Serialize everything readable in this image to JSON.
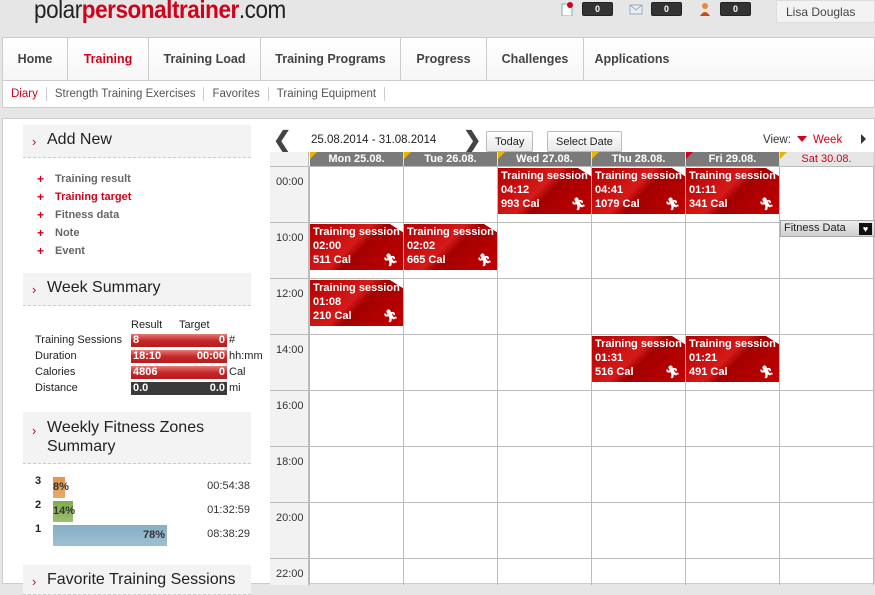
{
  "header": {
    "logo_prefix": "polar",
    "logo_brand": "personaltrainer",
    "logo_suffix": ".com",
    "notifications": [
      {
        "icon": "document-icon",
        "count": "0"
      },
      {
        "icon": "mail-icon",
        "count": "0"
      },
      {
        "icon": "person-icon",
        "count": "0"
      }
    ],
    "user_name": "Lisa Douglas"
  },
  "main_nav": [
    {
      "label": "Home",
      "active": false
    },
    {
      "label": "Training",
      "active": true
    },
    {
      "label": "Training Load",
      "active": false
    },
    {
      "label": "Training Programs",
      "active": false
    },
    {
      "label": "Progress",
      "active": false
    },
    {
      "label": "Challenges",
      "active": false
    },
    {
      "label": "Applications",
      "active": false
    }
  ],
  "sub_nav": [
    {
      "label": "Diary",
      "active": true
    },
    {
      "label": "Strength Training Exercises",
      "active": false
    },
    {
      "label": "Favorites",
      "active": false
    },
    {
      "label": "Training Equipment",
      "active": false
    }
  ],
  "sidebar": {
    "add_new": {
      "title": "Add New",
      "items": [
        "Training result",
        "Training target",
        "Fitness data",
        "Note",
        "Event"
      ]
    },
    "week_summary": {
      "title": "Week Summary",
      "col_result": "Result",
      "col_target": "Target",
      "rows": [
        {
          "label": "Training Sessions",
          "result": "8",
          "target": "0",
          "unit": "#"
        },
        {
          "label": "Duration",
          "result": "18:10",
          "target": "00:00",
          "unit": "hh:mm"
        },
        {
          "label": "Calories",
          "result": "4806",
          "target": "0",
          "unit": "Cal"
        },
        {
          "label": "Distance",
          "result": "0.0",
          "target": "0.0",
          "unit": "mi"
        }
      ]
    },
    "fitness_zones": {
      "title_line1": "Weekly Fitness Zones",
      "title_line2": "Summary",
      "zones": [
        {
          "zone": "3",
          "percent": "8%",
          "value": 8,
          "time": "00:54:38",
          "color": "#e0944a"
        },
        {
          "zone": "2",
          "percent": "14%",
          "value": 14,
          "time": "01:32:59",
          "color": "#7fae4c"
        },
        {
          "zone": "1",
          "percent": "78%",
          "value": 78,
          "time": "08:38:29",
          "color": "#86afc4"
        }
      ]
    },
    "favorites": {
      "title": "Favorite Training Sessions"
    }
  },
  "calendar": {
    "date_range": "25.08.2014 - 31.08.2014",
    "today_label": "Today",
    "select_date_label": "Select Date",
    "view_label": "View:",
    "view_value": "Week",
    "days": [
      {
        "label": "Mon 25.08.",
        "flag": "yellow"
      },
      {
        "label": "Tue 26.08.",
        "flag": "yellow"
      },
      {
        "label": "Wed 27.08.",
        "flag": "yellow"
      },
      {
        "label": "Thu 28.08.",
        "flag": "yellow"
      },
      {
        "label": "Fri 29.08.",
        "flag": "red"
      },
      {
        "label": "Sat 30.08.",
        "flag": "yellow"
      }
    ],
    "hours": [
      "00:00",
      "10:00",
      "12:00",
      "14:00",
      "16:00",
      "18:00",
      "20:00",
      "22:00"
    ],
    "sessions": [
      {
        "day": 2,
        "slot": 0,
        "title": "Training session",
        "duration": "04:12",
        "calories": "993 Cal"
      },
      {
        "day": 3,
        "slot": 0,
        "title": "Training session",
        "duration": "04:41",
        "calories": "1079 Cal"
      },
      {
        "day": 4,
        "slot": 0,
        "title": "Training session",
        "duration": "01:11",
        "calories": "341 Cal"
      },
      {
        "day": 0,
        "slot": 1,
        "title": "Training session",
        "duration": "02:00",
        "calories": "511 Cal"
      },
      {
        "day": 1,
        "slot": 1,
        "title": "Training session",
        "duration": "02:02",
        "calories": "665 Cal"
      },
      {
        "day": 0,
        "slot": 2,
        "title": "Training session",
        "duration": "01:08",
        "calories": "210 Cal"
      },
      {
        "day": 3,
        "slot": 3,
        "title": "Training session",
        "duration": "01:31",
        "calories": "516 Cal"
      },
      {
        "day": 4,
        "slot": 3,
        "title": "Training session",
        "duration": "01:21",
        "calories": "491 Cal"
      }
    ],
    "fitness_data_label": "Fitness Data"
  }
}
